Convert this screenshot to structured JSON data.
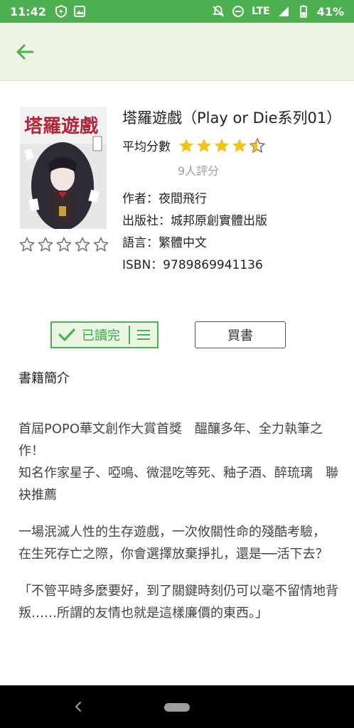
{
  "status_bar": {
    "time": "11:42",
    "network": "LTE",
    "battery": "41%"
  },
  "app_bar": {
    "back_icon": "arrow-left-icon",
    "accent": "#4caf50"
  },
  "book": {
    "title": "塔羅遊戲（Play or Die系列01）",
    "avg_label": "平均分數",
    "avg_rating": 4.5,
    "rating_count": "9人評分",
    "author": "作者：夜間飛行",
    "publisher": "出版社：城邦原創實體出版",
    "language": "語言：繁體中文",
    "isbn": "ISBN：9789869941136",
    "user_rating": 0
  },
  "actions": {
    "read_label": "已讀完",
    "buy_label": "買書"
  },
  "description": {
    "heading": "書籍簡介",
    "paragraphs": [
      "首屆POPO華文創作大賞首獎　醞釀多年、全力執筆之作！\n知名作家星子、啞鳴、微混吃等死、釉子酒、醉琉璃　聯袂推薦",
      "一場泯滅人性的生存遊戲，一次攸關性命的殘酷考驗，\n在生死存亡之際，你會選擇放棄掙扎，還是──活下去？",
      "「不管平時多麼要好，到了關鍵時刻仍可以毫不留情地背叛……所謂的友情也就是這樣廉價的東西。」"
    ]
  }
}
